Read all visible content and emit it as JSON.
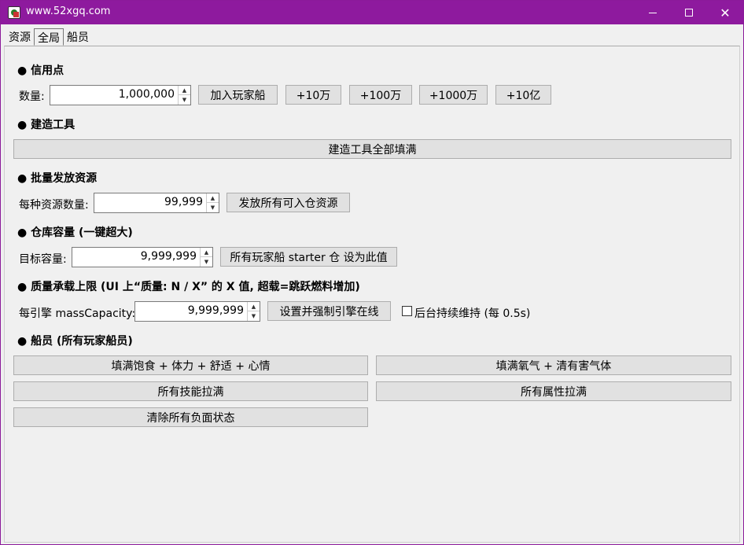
{
  "window": {
    "title": "www.52xgq.com"
  },
  "tabs": [
    "资源",
    "全局",
    "船员"
  ],
  "credits": {
    "header": "● 信用点",
    "qty_label": "数量:",
    "qty_value": "1,000,000",
    "btn_add": "加入玩家船",
    "btn_10w": "+10万",
    "btn_100w": "+100万",
    "btn_1000w": "+1000万",
    "btn_10yi": "+10亿"
  },
  "build": {
    "header": "● 建造工具",
    "btn_fill": "建造工具全部填满"
  },
  "batch": {
    "header": "● 批量发放资源",
    "label": "每种资源数量:",
    "value": "99,999",
    "btn": "发放所有可入仓资源"
  },
  "storage": {
    "header": "● 仓库容量 (一键超大)",
    "label": "目标容量:",
    "value": "9,999,999",
    "btn": "所有玩家船 starter 仓 设为此值"
  },
  "mass": {
    "header": "● 质量承载上限 (UI 上“质量: N / X” 的 X 值, 超载=跳跃燃料增加)",
    "label": "每引擎 massCapacity:",
    "value": "9,999,999",
    "btn": "设置并强制引擎在线",
    "checkbox_label": "后台持续维持 (每 0.5s)"
  },
  "crew": {
    "header": "● 船员 (所有玩家船员)",
    "btn_food": "填满饱食 + 体力 + 舒适 + 心情",
    "btn_oxygen": "填满氧气 + 清有害气体",
    "btn_skills": "所有技能拉满",
    "btn_attrs": "所有属性拉满",
    "btn_clear": "清除所有负面状态"
  }
}
